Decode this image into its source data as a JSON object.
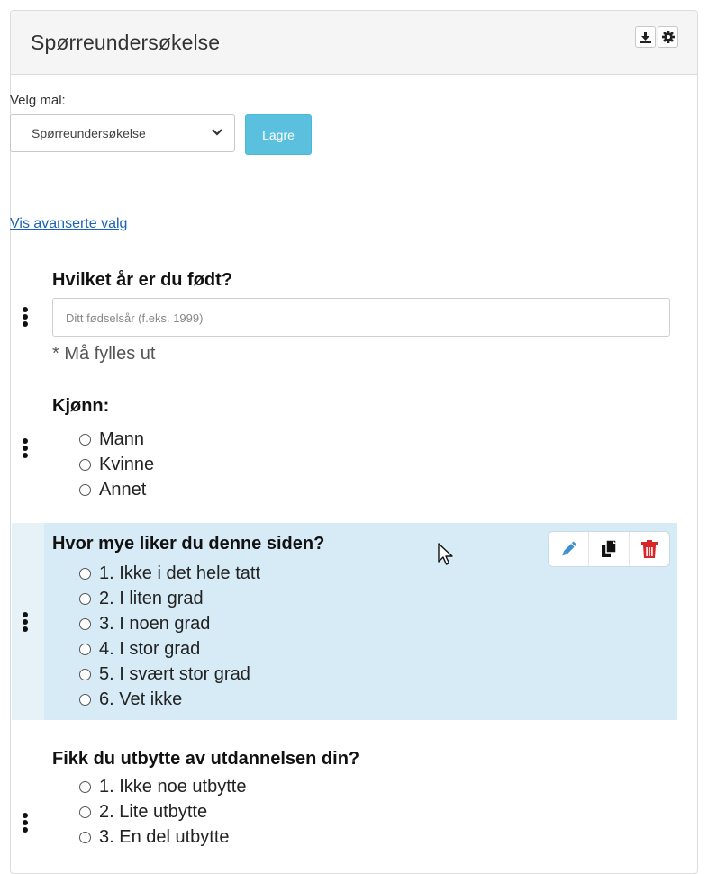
{
  "header": {
    "title": "Spørreundersøkelse",
    "icons": [
      "download-icon",
      "gear-icon"
    ]
  },
  "template": {
    "label": "Velg mal:",
    "selected": "Spørreundersøkelse",
    "save_label": "Lagre"
  },
  "advanced_link": "Vis avanserte valg",
  "questions": [
    {
      "title": "Hvilket år er du født?",
      "placeholder": "Ditt fødselsår (f.eks. 1999)",
      "required_note": "* Må fylles ut"
    },
    {
      "title": "Kjønn:",
      "options": [
        "Mann",
        "Kvinne",
        "Annet"
      ]
    },
    {
      "title": "Hvor mye liker du denne siden?",
      "options": [
        "1. Ikke i det hele tatt",
        "2. I liten grad",
        "3. I noen grad",
        "4. I stor grad",
        "5. I svært stor grad",
        "6. Vet ikke"
      ],
      "actions": [
        "pencil-icon",
        "copy-icon",
        "trash-icon"
      ]
    },
    {
      "title": "Fikk du utbytte av utdannelsen din?",
      "options": [
        "1. Ikke noe utbytte",
        "2. Lite utbytte",
        "3. En del utbytte"
      ]
    }
  ],
  "colors": {
    "save_button": "#5bc0de",
    "highlight_row": "#d7ebf6",
    "edit_icon": "#3d8fd1",
    "delete_icon": "#d9262a",
    "link": "#1a63b8"
  }
}
